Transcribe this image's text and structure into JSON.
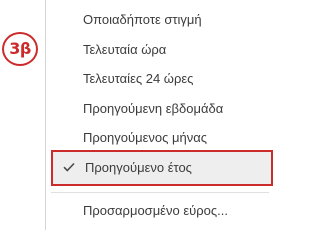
{
  "annotation": {
    "step_label": "3β",
    "color": "#cc2b2b"
  },
  "menu": {
    "items": [
      {
        "label": "Οποιαδήποτε στιγμή"
      },
      {
        "label": "Τελευταία ώρα"
      },
      {
        "label": "Τελευταίες 24 ώρες"
      },
      {
        "label": "Προηγούμενη εβδομάδα"
      },
      {
        "label": "Προηγούμενος μήνας"
      },
      {
        "label": "Προηγούμενο έτος",
        "selected": true,
        "icon": "check-icon"
      },
      {
        "label": "Προσαρμοσμένο εύρος..."
      }
    ]
  }
}
